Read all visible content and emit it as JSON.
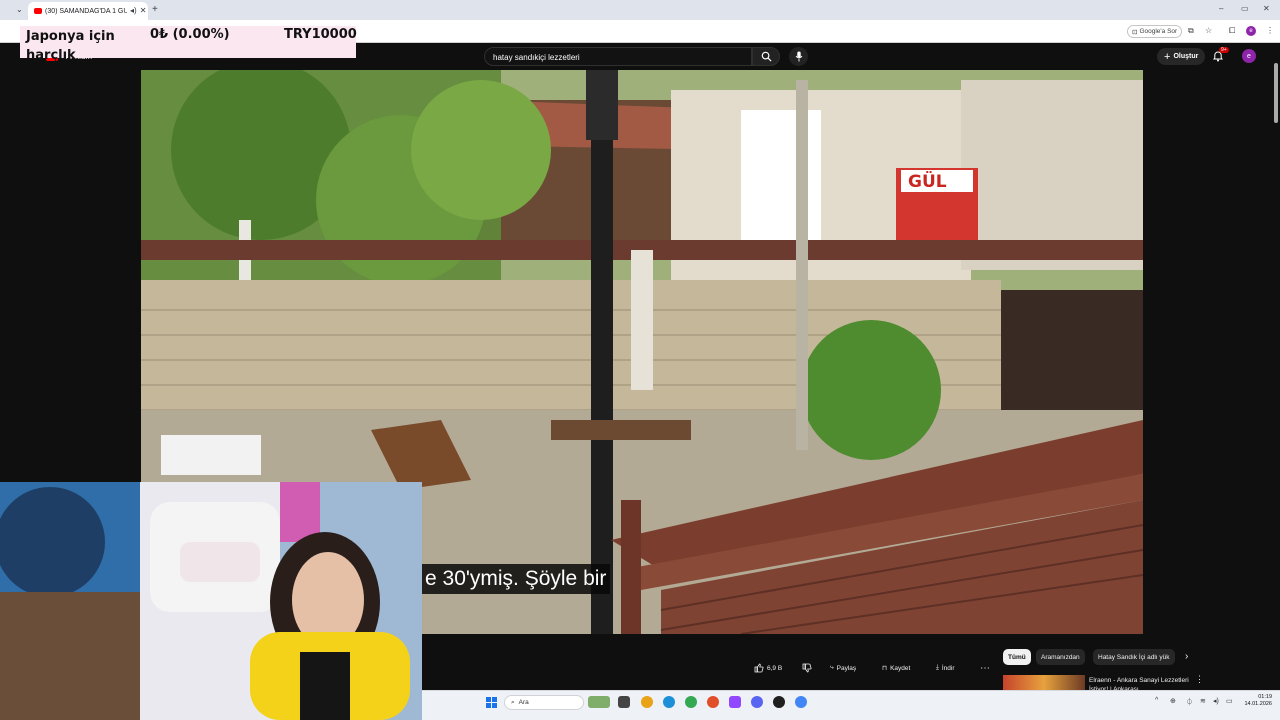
{
  "browser": {
    "tab_title": "(30) SAMANDAĞ'DA 1 GÜN",
    "new_tab": "+",
    "window_controls": [
      "–",
      "▭",
      "✕"
    ],
    "toolbar_action": "Google'a Sor",
    "profile_initial": "e"
  },
  "donation_widget": {
    "label": "Japonya için harçlık",
    "amount": "0₺ (0.00%)",
    "goal": "TRY10000"
  },
  "youtube_header": {
    "logo_text": "Premium",
    "search_value": "hatay sandıkiçi lezzetleri",
    "create_label": "Oluştur",
    "notification_count": "9+",
    "avatar_initial": "e"
  },
  "video": {
    "subtitle": "e 30'ymiş. Şöyle bir",
    "sign_text": "GÜL"
  },
  "actions": {
    "like_count": "6,9 B",
    "share_label": "Paylaş",
    "save_label": "Kaydet",
    "download_label": "İndir",
    "more": "⋯"
  },
  "filter_chips": [
    {
      "label": "Tümü",
      "selected": true
    },
    {
      "label": "Aramanızdan",
      "selected": false
    },
    {
      "label": "Hatay Sandık İçi adlı yük",
      "selected": false
    }
  ],
  "recommendation": {
    "title": "Elraenn - Ankara Sanayi Lezzetleri İstiyor! | Ankarası"
  },
  "taskbar": {
    "search_placeholder": "Ara",
    "time": "01:19",
    "date": "14.01.2026"
  },
  "colors": {
    "youtube_bg": "#0f0f0f",
    "accent_red": "#ff0000",
    "donation_bg": "#fbe7ef",
    "taskbar_bg": "#eef1f6"
  }
}
